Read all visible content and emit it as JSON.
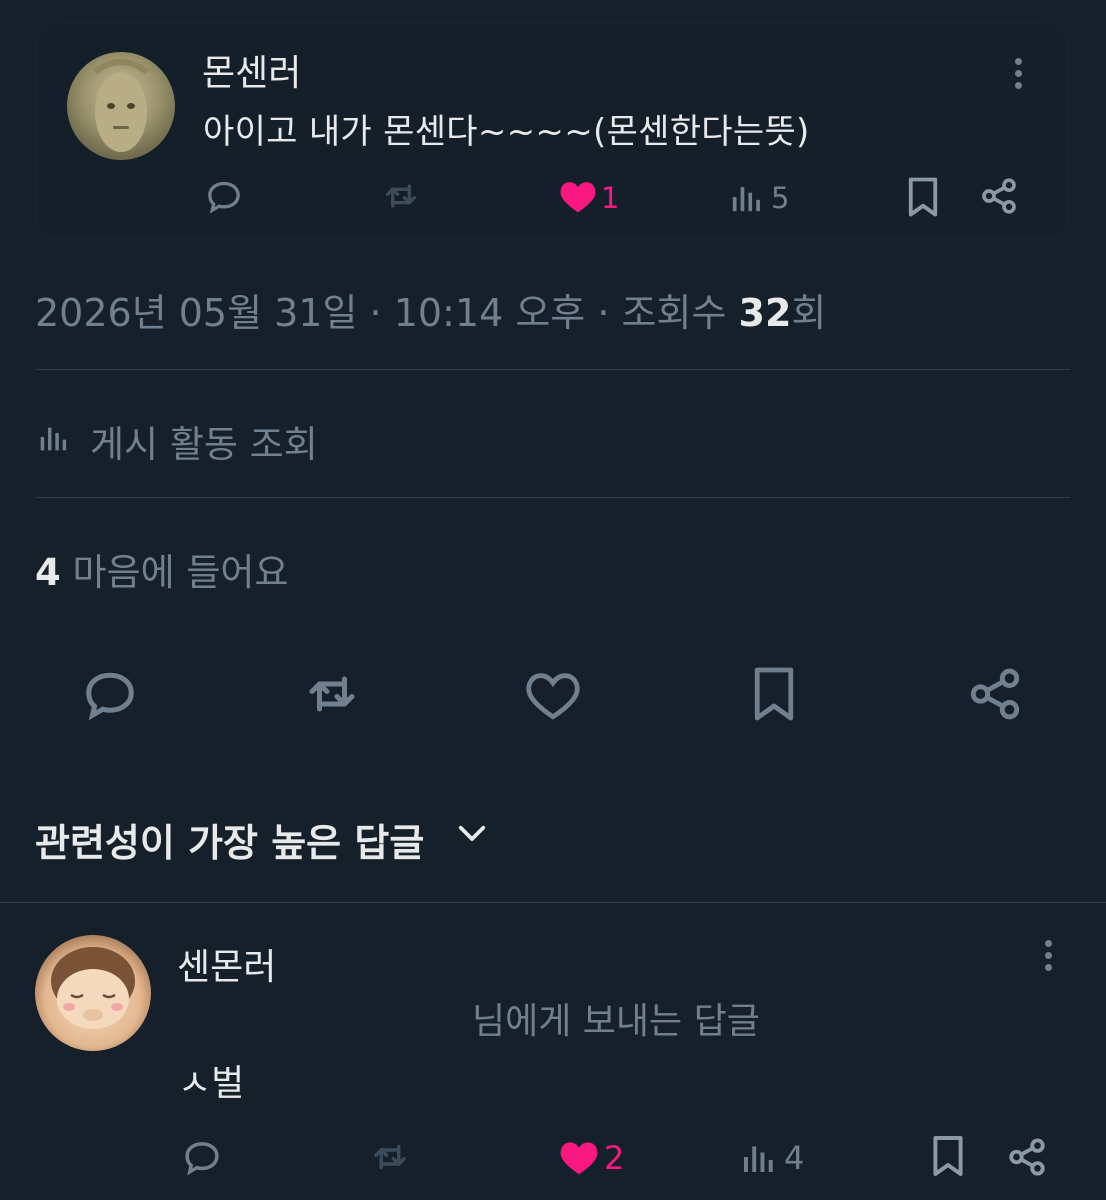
{
  "quoted_post": {
    "author": "몬센러",
    "text": "아이고 내가 몬센다~~~~(몬센한다는뜻)",
    "like_count": "1",
    "view_count": "5",
    "icons": [
      "reply-icon",
      "retweet-icon",
      "heart-filled-icon",
      "views-icon",
      "bookmark-icon",
      "share-icon",
      "more-icon"
    ]
  },
  "meta": {
    "date": "2026년 05월 31일",
    "time": "10:14 오후",
    "views_label": "조회수",
    "views_value": "32",
    "views_suffix": "회",
    "separator": "·"
  },
  "activity": {
    "label": "게시 활동 조회"
  },
  "likes": {
    "count": "4",
    "label": "마음에 들어요"
  },
  "sort": {
    "label": "관련성이 가장 높은 답글"
  },
  "reply": {
    "author": "센몬러",
    "reply_to": "님에게 보내는 답글",
    "text": "ㅅ벌",
    "like_count": "2",
    "view_count": "4"
  },
  "colors": {
    "background": "#15202b",
    "text": "#e7e9ea",
    "secondary": "#71808f",
    "like": "#f91880",
    "divider": "#2f3b47"
  }
}
